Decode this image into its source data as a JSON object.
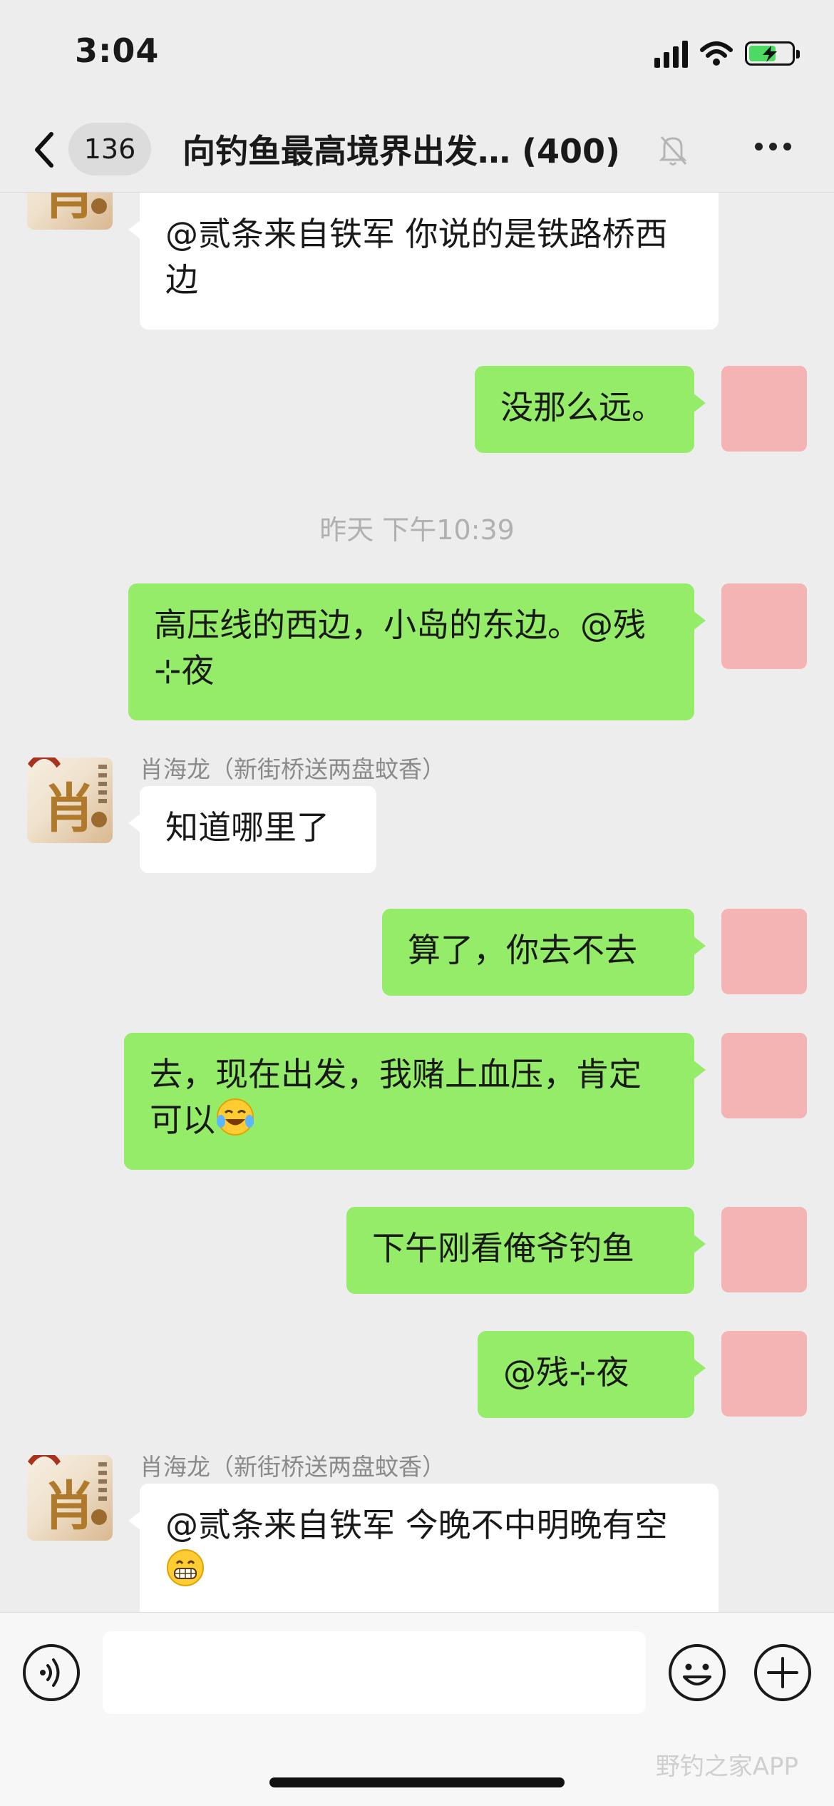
{
  "status_bar": {
    "time": "3:04",
    "icons": [
      "signal-icon",
      "wifi-icon",
      "battery-charging-icon"
    ]
  },
  "nav": {
    "back_icon": "chevron-left-icon",
    "unread_count": "136",
    "title": "向钓鱼最高境界出发…",
    "member_count": "(400)",
    "mute_icon": "bell-muted-icon",
    "more_icon": "more-dots-icon"
  },
  "messages": [
    {
      "direction": "incoming",
      "text": "@贰条来自铁军 你说的是铁路桥西边"
    },
    {
      "direction": "outgoing",
      "text": "没那么远。"
    },
    {
      "type": "timestamp",
      "text": "昨天 下午10:39"
    },
    {
      "direction": "outgoing",
      "text": "高压线的西边，小岛的东边。@残⊹夜"
    },
    {
      "direction": "incoming",
      "sender": "肖海龙（新街桥送两盘蚊香）",
      "text": "知道哪里了"
    },
    {
      "direction": "outgoing",
      "text": "算了，你去不去"
    },
    {
      "direction": "outgoing",
      "text": "去，现在出发，我赌上血压，肯定可以",
      "emoji": "laughing-crying-emoji"
    },
    {
      "direction": "outgoing",
      "text": "下午刚看俺爷钓鱼"
    },
    {
      "direction": "outgoing",
      "text": "@残⊹夜"
    },
    {
      "direction": "incoming",
      "sender": "肖海龙（新街桥送两盘蚊香）",
      "text": "@贰条来自铁军 今晚不中明晚有空",
      "emoji": "grinning-emoji"
    }
  ],
  "avatar_glyph": "肖",
  "input_bar": {
    "voice_icon": "voice-icon",
    "emoji_icon": "emoji-icon",
    "plus_icon": "plus-icon",
    "input_value": ""
  },
  "watermark": "野钓之家APP",
  "colors": {
    "outgoing_bubble": "#95ec69",
    "incoming_bubble": "#ffffff",
    "background": "#ededed"
  }
}
